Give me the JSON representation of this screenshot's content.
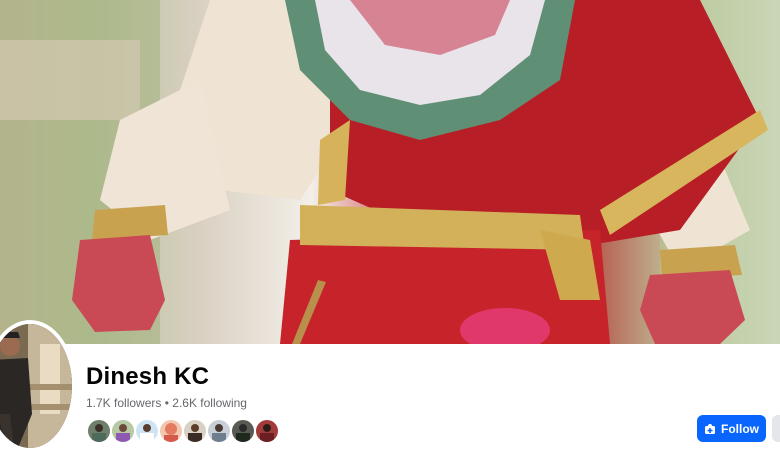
{
  "profile": {
    "name": "Dinesh KC",
    "followers": "1.7K followers",
    "separator": "•",
    "following": "2.6K following"
  },
  "actions": {
    "follow_label": "Follow"
  },
  "friends": {
    "avatar_count": 8
  },
  "colors": {
    "accent": "#0866ff",
    "secondary_button": "#e4e6eb",
    "muted_text": "#65676b"
  }
}
